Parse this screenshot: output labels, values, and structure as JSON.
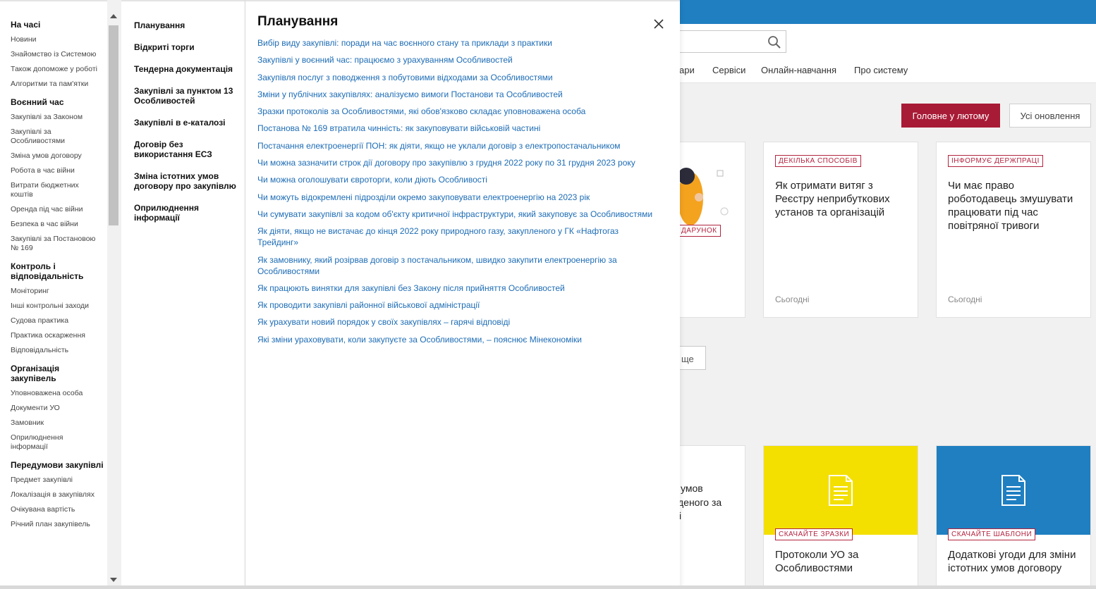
{
  "background": {
    "nav": [
      "ари",
      "Сервіси",
      "Онлайн-навчання",
      "Про систему"
    ],
    "btn_main": "Головне у лютому",
    "btn_all": "Усі оновлення",
    "card1": {
      "badge": "ДАРУНОК",
      "fragment": "!"
    },
    "card2": {
      "badge": "ДЕКІЛЬКА СПОСОБІВ",
      "title": "Як отримати витяг з Реєстру неприбуткових установ та організацій",
      "date": "Сьогодні"
    },
    "card3": {
      "badge": "ІНФОРМУЄ ДЕРЖПРАЦІ",
      "title": "Чи має право роботодавець змушувати працювати під час повітряної тривоги",
      "date": "Сьогодні"
    },
    "more_btn": "ще",
    "card4": {
      "lines": [
        "умов",
        "деного за",
        "і"
      ]
    },
    "card5": {
      "badge": "СКАЧАЙТЕ ЗРАЗКИ",
      "title": "Протоколи УО за Особливостями"
    },
    "card6": {
      "badge": "СКАЧАЙТЕ ШАБЛОНИ",
      "title": "Додаткові угоди для зміни істотних умов договору"
    }
  },
  "menu": {
    "left_sections": [
      {
        "title": "На часі",
        "items": [
          "Новини",
          "Знайомство із Системою",
          "Також допоможе у роботі",
          "Алгоритми та пам'ятки"
        ]
      },
      {
        "title": "Воєнний час",
        "items": [
          "Закупівлі за Законом",
          "Закупівлі за Особливостями",
          "Зміна умов договору",
          "Робота в час війни",
          "Витрати бюджетних коштів",
          "Оренда під час війни",
          "Безпека в час війни",
          "Закупівлі за Постановою № 169"
        ]
      },
      {
        "title": "Контроль і відповідальність",
        "items": [
          "Моніторинг",
          "Інші контрольні заходи",
          "Судова практика",
          "Практика оскарження",
          "Відповідальність"
        ]
      },
      {
        "title": "Організація закупівель",
        "items": [
          "Уповноважена особа",
          "Документи УО",
          "Замовник",
          "Оприлюднення інформації"
        ]
      },
      {
        "title": "Передумови закупівлі",
        "items": [
          "Предмет закупівлі",
          "Локалізація в закупівлях",
          "Очікувана вартість",
          "Річний план закупівель"
        ]
      }
    ],
    "categories": [
      "Планування",
      "Відкриті торги",
      "Тендерна документація",
      "Закупівлі за пунктом 13 Особливостей",
      "Закупівлі в е-каталозі",
      "Договір без використання ЕСЗ",
      "Зміна істотних умов договору про закупівлю",
      "Оприлюднення інформації"
    ],
    "panel_title": "Планування",
    "links": [
      "Вибір виду закупівлі: поради на час воєнного стану та приклади з практики",
      "Закупівлі у воєнний час: працюємо з урахуванням Особливостей",
      "Закупівля послуг з поводження з побутовими відходами за Особливостями",
      "Зміни у публічних закупівлях: аналізуємо вимоги Постанови та Особливостей",
      "Зразки протоколів за Особливостями, які обов'язково складає уповноважена особа",
      "Постанова № 169 втратила чинність: як закуповувати військовій частині",
      "Постачання електроенергії ПОН: як діяти, якщо не уклали договір з електропостачальником",
      "Чи можна зазначити строк дії договору про закупівлю з грудня 2022 року по 31 грудня 2023 року",
      "Чи можна оголошувати євроторги, коли діють Особливості",
      "Чи можуть відокремлені підрозділи окремо закуповувати електроенергію на 2023 рік",
      "Чи сумувати закупівлі за кодом об'єкту критичної інфраструктури, який закуповує за Особливостями",
      "Як діяти, якщо не вистачає до кінця 2022 року природного газу, закупленого у ГК «Нафтогаз Трейдинг»",
      "Як замовнику, який розірвав договір з постачальником, швидко закупити електроенергію за Особливостями",
      "Як працюють винятки для закупівлі без Закону після прийняття Особливостей",
      "Як проводити закупівлі районної військової адміністрації",
      "Як урахувати новий порядок у своїх закупівлях – гарячі відповіді",
      "Які зміни ураховувати, коли закупуєте за Особливостями, – пояснює Мінекономіки"
    ]
  }
}
